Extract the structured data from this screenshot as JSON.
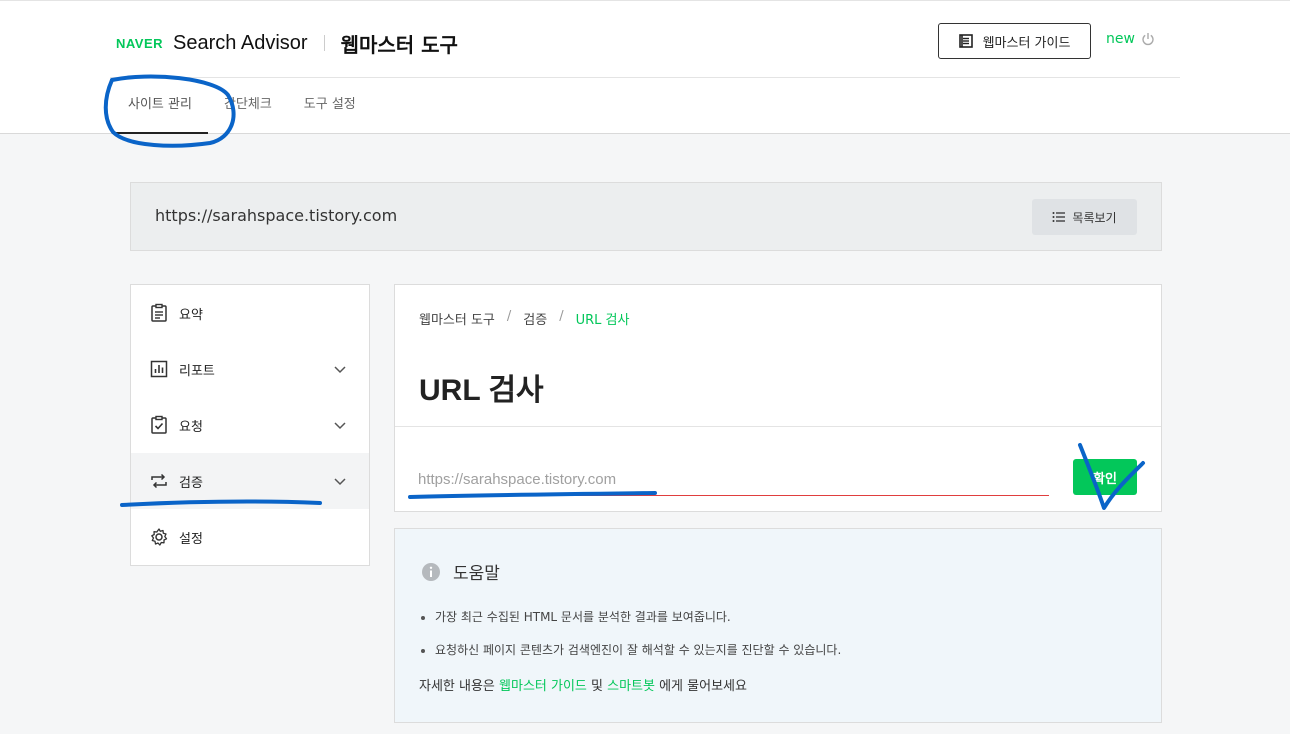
{
  "header": {
    "naver_logo": "NAVER",
    "app_name": "Search Advisor",
    "tool_name": "웹마스터 도구",
    "guide_button": "웹마스터 가이드",
    "user_label": "new"
  },
  "tabs": [
    {
      "label": "사이트 관리",
      "active": true
    },
    {
      "label": "간단체크",
      "active": false
    },
    {
      "label": "도구 설정",
      "active": false
    }
  ],
  "site": {
    "url": "https://sarahspace.tistory.com",
    "list_button": "목록보기"
  },
  "sidebar": {
    "items": [
      {
        "label": "요약",
        "icon": "clipboard-icon",
        "has_chevron": false
      },
      {
        "label": "리포트",
        "icon": "chart-icon",
        "has_chevron": true
      },
      {
        "label": "요청",
        "icon": "check-clipboard-icon",
        "has_chevron": true
      },
      {
        "label": "검증",
        "icon": "repeat-arrows-icon",
        "has_chevron": true,
        "active": true
      },
      {
        "label": "설정",
        "icon": "gear-icon",
        "has_chevron": false
      }
    ]
  },
  "breadcrumb": {
    "items": [
      "웹마스터 도구",
      "검증",
      "URL 검사"
    ],
    "separator": "/"
  },
  "main": {
    "title": "URL 검사",
    "input_placeholder": "https://sarahspace.tistory.com",
    "input_value": "",
    "confirm_button": "확인"
  },
  "help": {
    "title": "도움말",
    "bullets": [
      "가장 최근 수집된 HTML 문서를 분석한 결과를 보여줍니다.",
      "요청하신 페이지 콘텐츠가 검색엔진이 잘 해석할 수 있는지를 진단할 수 있습니다."
    ],
    "footer_prefix": "자세한 내용은 ",
    "footer_link1": "웹마스터 가이드",
    "footer_mid": " 및 ",
    "footer_link2": "스마트봇",
    "footer_suffix": " 에게 물어보세요"
  },
  "colors": {
    "brand_green": "#03c75a",
    "annotation_blue": "#0a64c8",
    "input_underline_red": "#e03e3e"
  }
}
